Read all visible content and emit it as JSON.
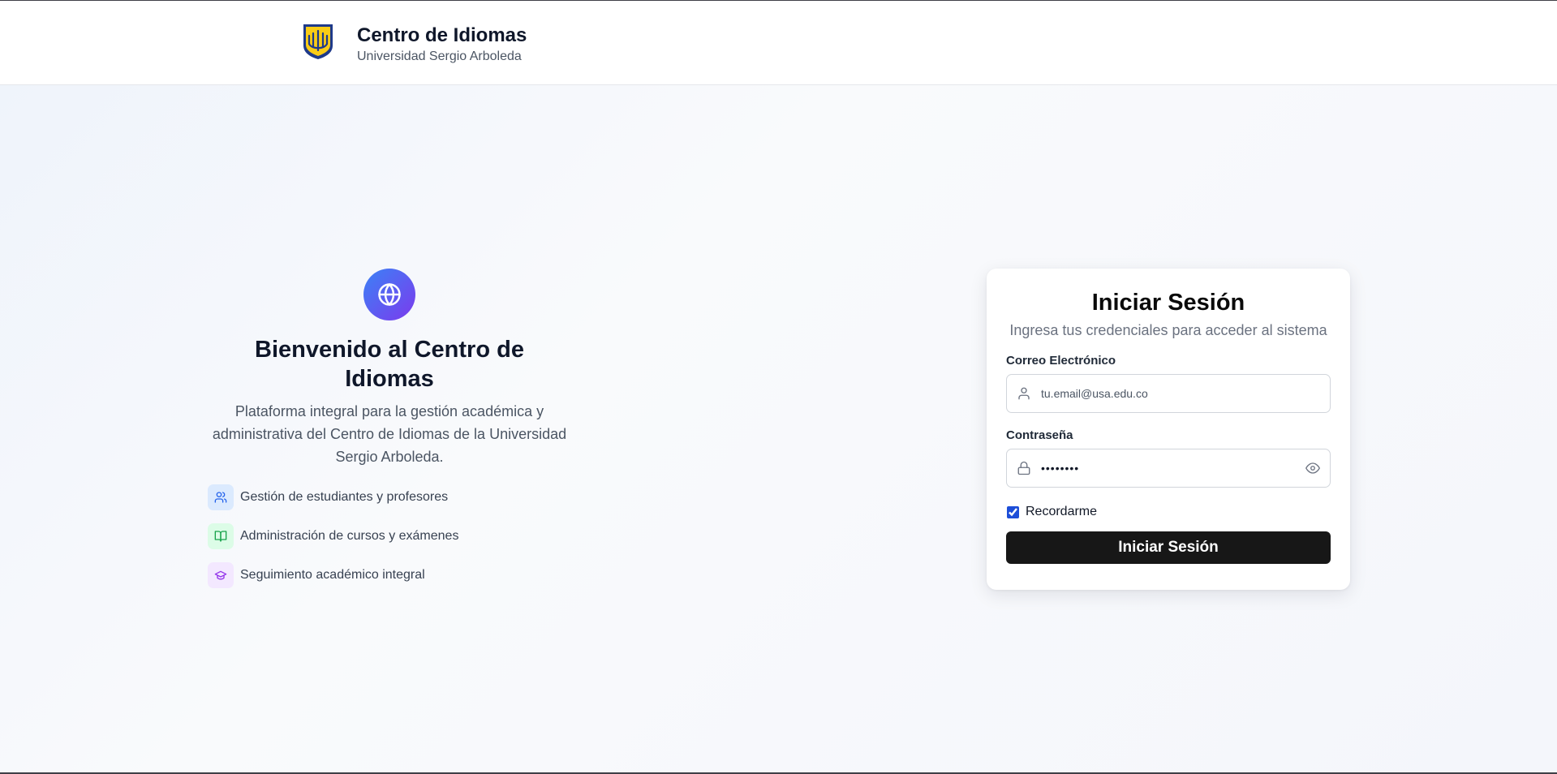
{
  "header": {
    "title": "Centro de Idiomas",
    "subtitle": "Universidad Sergio Arboleda",
    "logo_icon": "university-shield-logo"
  },
  "intro": {
    "icon": "globe-icon",
    "heading": "Bienvenido al Centro de Idiomas",
    "description": "Plataforma integral para la gestión académica y administrativa del Centro de Idiomas de la Universidad Sergio Arboleda.",
    "features": [
      {
        "label": "Gestión de estudiantes y profesores",
        "icon": "users-icon",
        "color": "#2563eb"
      },
      {
        "label": "Administración de cursos y exámenes",
        "icon": "book-open-icon",
        "color": "#16a34a"
      },
      {
        "label": "Seguimiento académico integral",
        "icon": "graduation-cap-icon",
        "color": "#9333ea"
      }
    ]
  },
  "login": {
    "title": "Iniciar Sesión",
    "subtitle": "Ingresa tus credenciales para acceder al sistema",
    "email_label": "Correo Electrónico",
    "email_placeholder": "tu.email@usa.edu.co",
    "email_value": "",
    "password_label": "Contraseña",
    "password_value": "••••••••",
    "remember_label": "Recordarme",
    "remember_checked": true,
    "submit_label": "Iniciar Sesión"
  },
  "colors": {
    "accent_gradient_start": "#3b82f6",
    "accent_gradient_end": "#7c3aed",
    "button_bg": "#171717",
    "checkbox": "#1d4ed8"
  }
}
